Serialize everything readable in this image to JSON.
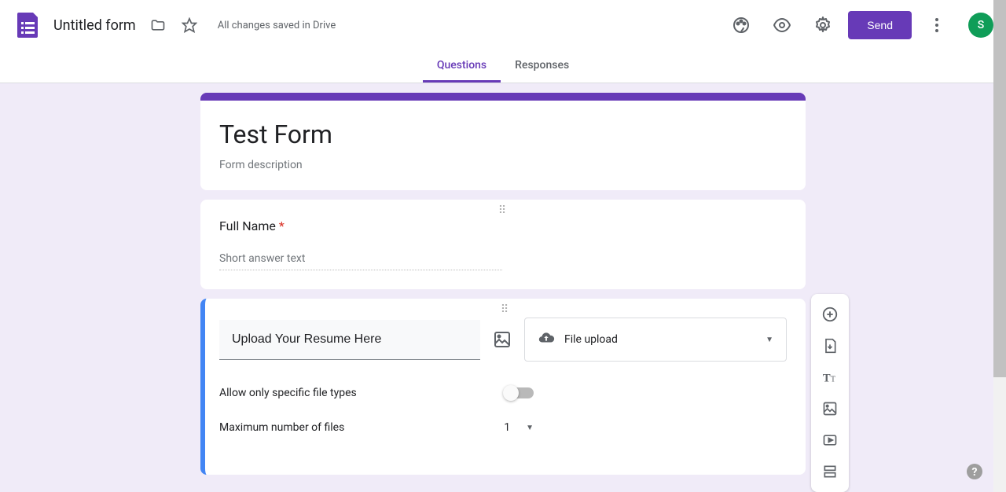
{
  "header": {
    "title": "Untitled form",
    "save_status": "All changes saved in Drive",
    "send_label": "Send",
    "avatar_initial": "S"
  },
  "tabs": {
    "questions": "Questions",
    "responses": "Responses"
  },
  "form": {
    "title": "Test Form",
    "description_placeholder": "Form description"
  },
  "questions": [
    {
      "label": "Full Name",
      "required": true,
      "answer_placeholder": "Short answer text"
    },
    {
      "label": "Upload Your Resume Here",
      "type_label": "File upload",
      "options": {
        "allow_specific_types_label": "Allow only specific file types",
        "max_files_label": "Maximum number of files",
        "max_files_value": "1"
      }
    }
  ],
  "icons": {
    "folder": "folder-icon",
    "star": "star-icon",
    "palette": "palette-icon",
    "preview": "preview-icon",
    "settings": "settings-icon",
    "more": "more-icon",
    "image": "image-icon",
    "cloud_upload": "cloud-upload-icon",
    "add": "add-icon",
    "import": "import-icon",
    "text": "text-icon",
    "add_image": "add-image-icon",
    "video": "video-icon",
    "section": "section-icon",
    "help": "help-icon"
  }
}
